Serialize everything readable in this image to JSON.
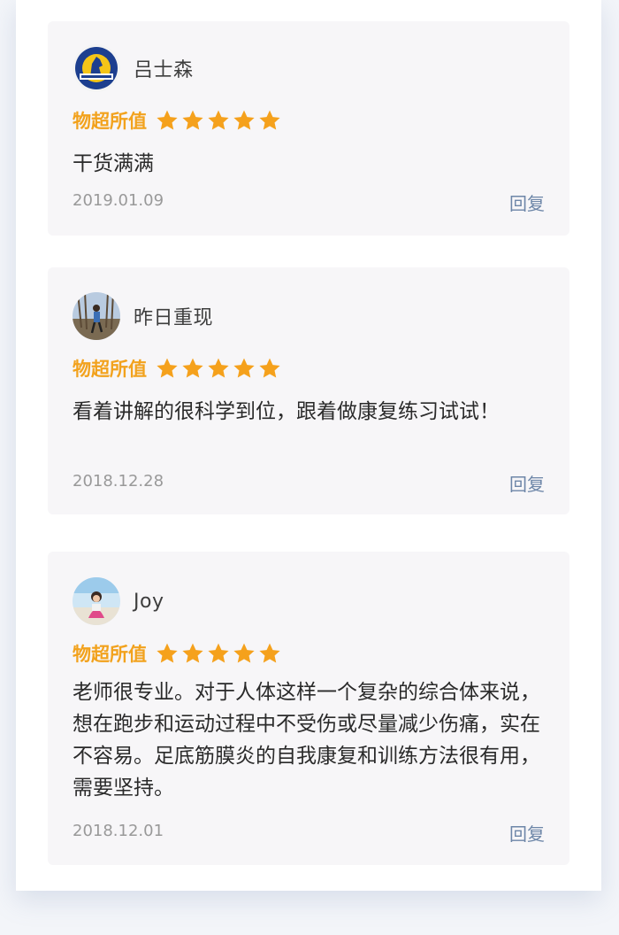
{
  "reviews": [
    {
      "username": "吕士森",
      "rating_label": "物超所值",
      "stars": 5,
      "content": "干货满满",
      "date": "2019.01.09",
      "reply_label": "回复"
    },
    {
      "username": "昨日重现",
      "rating_label": "物超所值",
      "stars": 5,
      "content": "看着讲解的很科学到位，跟着做康复练习试试！",
      "date": "2018.12.28",
      "reply_label": "回复"
    },
    {
      "username": "Joy",
      "rating_label": "物超所值",
      "stars": 5,
      "content": "老师很专业。对于人体这样一个复杂的综合体来说，想在跑步和运动过程中不受伤或尽量减少伤痛，实在不容易。足底筋膜炎的自我康复和训练方法很有用，需要坚持。",
      "date": "2018.12.01",
      "reply_label": "回复"
    }
  ],
  "colors": {
    "rating_label": "#f2a21d",
    "star": "#f5a11c",
    "reply": "#6d86a8",
    "date": "#999999",
    "card_bg": "#f7f6f8"
  },
  "icons": {
    "avatar_1": "marathon-logo-avatar",
    "avatar_2": "runner-photo-avatar",
    "avatar_3": "girl-photo-avatar",
    "star": "star-icon"
  }
}
